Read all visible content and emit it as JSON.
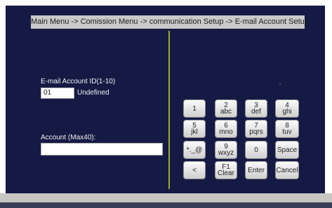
{
  "breadcrumb": "Main Menu -> Comission Menu -> communication Setup -> E-mail Account Setup",
  "account_id": {
    "label": "E-mail Account ID(1-10)",
    "value": "01",
    "status": "Undefined"
  },
  "account": {
    "label": "Account (Max40):",
    "value": ""
  },
  "keypad": {
    "k1": {
      "digit": "1",
      "letters": ""
    },
    "k2": {
      "digit": "2",
      "letters": "abc"
    },
    "k3": {
      "digit": "3",
      "letters": "def"
    },
    "k4": {
      "digit": "4",
      "letters": "ghi"
    },
    "k5": {
      "digit": "5",
      "letters": "jkl"
    },
    "k6": {
      "digit": "6",
      "letters": "mno"
    },
    "k7": {
      "digit": "7",
      "letters": "pqrs"
    },
    "k8": {
      "digit": "8",
      "letters": "tuv"
    },
    "symbols": "*._@",
    "k9": {
      "digit": "9",
      "letters": "wxyz"
    },
    "k0": "0",
    "space": "Space",
    "back": "<",
    "f1": {
      "line1": "F1",
      "line2": "Clear"
    },
    "enter": "Enter",
    "cancel": "Cancel"
  },
  "colors": {
    "screen_bg": "#151a45",
    "divider": "#9aa824",
    "breadcrumb_bg": "#c9c9c9"
  }
}
